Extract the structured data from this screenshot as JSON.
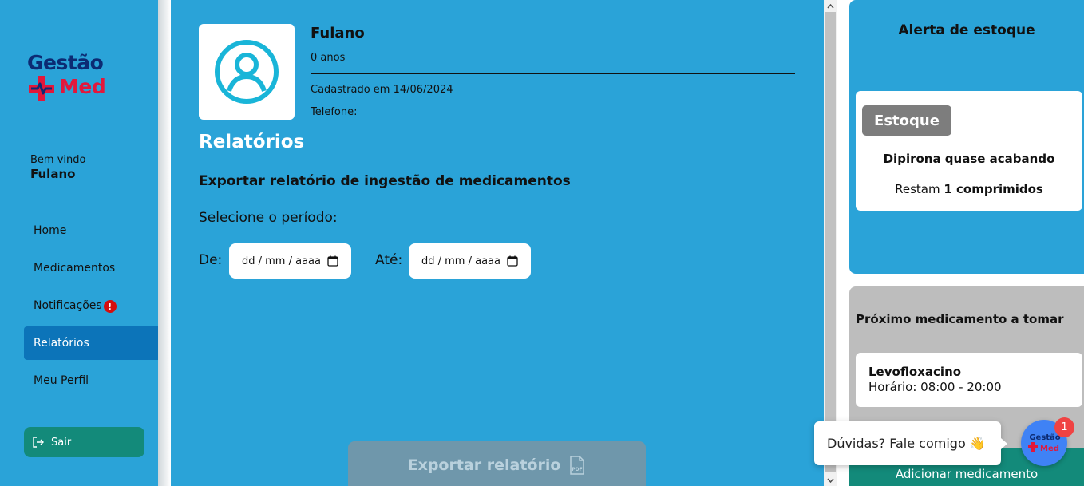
{
  "app": {
    "logo_top": "Gestão",
    "logo_bottom": "Med",
    "brand_blue": "#0c2b73",
    "brand_red": "#e3173b",
    "accent": "#2aa3d8"
  },
  "sidebar": {
    "welcome_label": "Bem vindo",
    "welcome_name": "Fulano",
    "items": [
      {
        "label": "Home",
        "active": false
      },
      {
        "label": "Medicamentos",
        "active": false
      },
      {
        "label": "Notificações",
        "active": false,
        "badge": "!"
      },
      {
        "label": "Relatórios",
        "active": true
      },
      {
        "label": "Meu Perfil",
        "active": false
      }
    ],
    "logout_label": "Sair",
    "logout_icon": "logout-icon"
  },
  "profile": {
    "name": "Fulano",
    "age": "0 anos",
    "registered": "Cadastrado em 14/06/2024",
    "phone": "Telefone:",
    "avatar_icon": "user-circle-icon"
  },
  "report": {
    "section_title": "Relatórios",
    "export_title": "Exportar relatório de ingestão de medicamentos",
    "period_label": "Selecione o período:",
    "from_label": "De:",
    "from_value": "dd / mm / aaaa",
    "to_label": "Até:",
    "to_value": "dd / mm / aaaa",
    "calendar_icon": "calendar-icon",
    "export_button": "Exportar relatório",
    "export_icon": "pdf-icon"
  },
  "stock_alert": {
    "title": "Alerta de estoque",
    "badge": "Estoque",
    "message": "Dipirona quase acabando",
    "remaining_prefix": "Restam ",
    "remaining_value": "1 comprimidos"
  },
  "next_medication": {
    "title": "Próximo medicamento a tomar",
    "name": "Levofloxacino",
    "schedule": "Horário: 08:00 - 20:00",
    "add_button": "Adicionar medicamento"
  },
  "chat": {
    "message": "Dúvidas? Fale comigo 👋",
    "badge_count": "1",
    "avatar_logo_top": "Gestão",
    "avatar_logo_bottom": "Med"
  }
}
